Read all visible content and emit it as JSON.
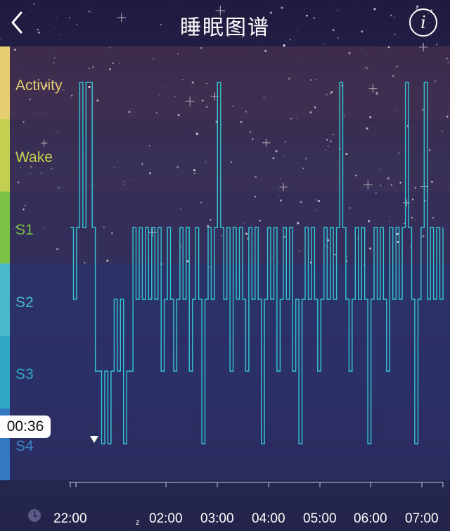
{
  "header": {
    "title": "睡眠图谱",
    "back_icon": "chevron-left-icon",
    "info_icon": "info-icon",
    "info_glyph": "i"
  },
  "stages": [
    {
      "label": "Activity",
      "color": "#e7cd72"
    },
    {
      "label": "Wake",
      "color": "#c3cf4e"
    },
    {
      "label": "S1",
      "color": "#79c246"
    },
    {
      "label": "S2",
      "color": "#49b8c9"
    },
    {
      "label": "S3",
      "color": "#2fa8c6"
    },
    {
      "label": "S4",
      "color": "#3279c2"
    }
  ],
  "selected_time": "00:36",
  "axis": {
    "clock_icon": "clock-icon",
    "moon_icon_text": "z",
    "tick_labels": [
      "22:00",
      "02:00",
      "03:00",
      "04:00",
      "05:00",
      "06:00",
      "07:00"
    ]
  },
  "chart_data": {
    "type": "line",
    "line_color": "#35c6d6",
    "y_categories": [
      "Activity",
      "Wake",
      "S1",
      "S2",
      "S3",
      "S4"
    ],
    "x_range": [
      "22:00",
      "07:25"
    ],
    "selected_marker": "00:36",
    "series": [
      {
        "values": [
          2,
          3,
          2,
          0,
          2,
          0,
          0,
          2,
          4,
          4,
          5,
          4,
          5,
          4,
          3,
          4,
          3,
          5,
          4,
          4,
          2,
          3,
          2,
          3,
          2,
          3,
          2,
          3,
          2,
          4,
          3,
          2,
          3,
          4,
          3,
          2,
          3,
          2,
          4,
          3,
          2,
          3,
          5,
          3,
          2,
          3,
          2,
          0,
          2,
          3,
          2,
          4,
          2,
          3,
          2,
          3,
          4,
          2,
          3,
          2,
          3,
          5,
          3,
          2,
          3,
          2,
          4,
          3,
          2,
          3,
          2,
          4,
          3,
          5,
          3,
          2,
          3,
          2,
          3,
          4,
          3,
          2,
          3,
          2,
          3,
          2,
          0,
          2,
          3,
          4,
          3,
          2,
          3,
          2,
          3,
          5,
          3,
          2,
          3,
          2,
          3,
          4,
          2,
          3,
          2,
          3,
          2,
          0,
          2,
          3,
          5,
          3,
          2,
          0,
          3,
          2,
          3,
          2,
          3,
          2
        ]
      }
    ]
  }
}
